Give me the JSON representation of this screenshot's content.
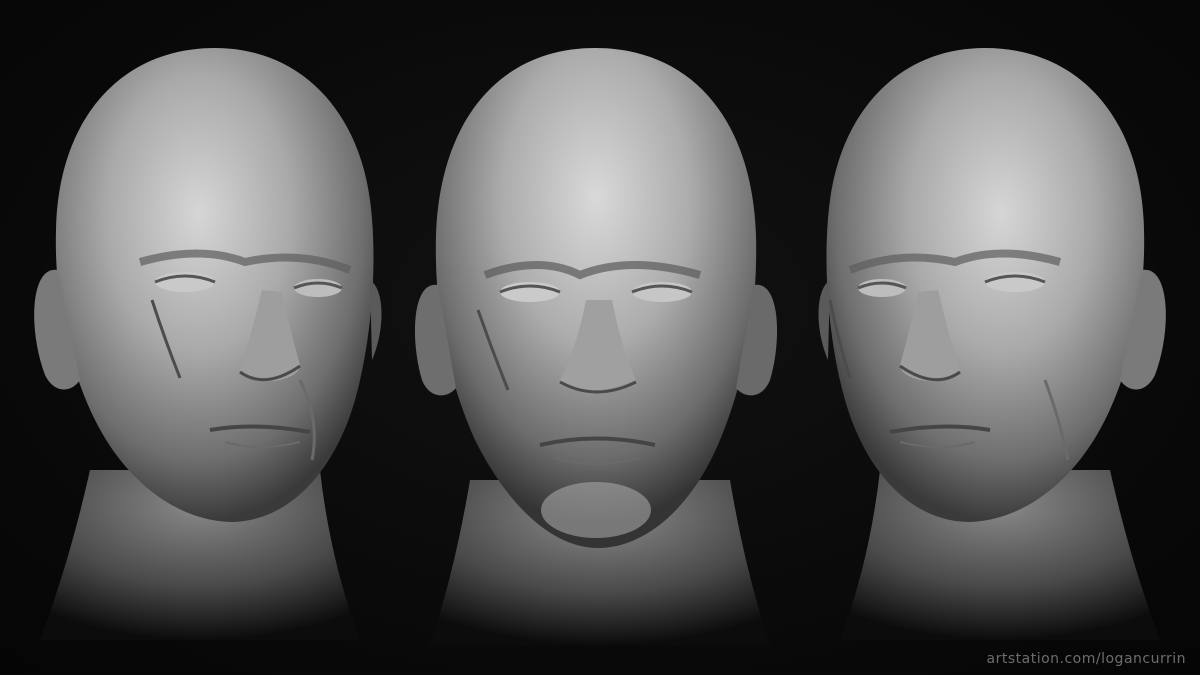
{
  "image": {
    "description_views": [
      "three-quarter-left",
      "front",
      "three-quarter-right"
    ],
    "background_color": "#0b0b0b",
    "sculpt_color": "#9a9a9a"
  },
  "watermark": {
    "text": "artstation.com/logancurrin",
    "color": "#6d6d6d"
  }
}
